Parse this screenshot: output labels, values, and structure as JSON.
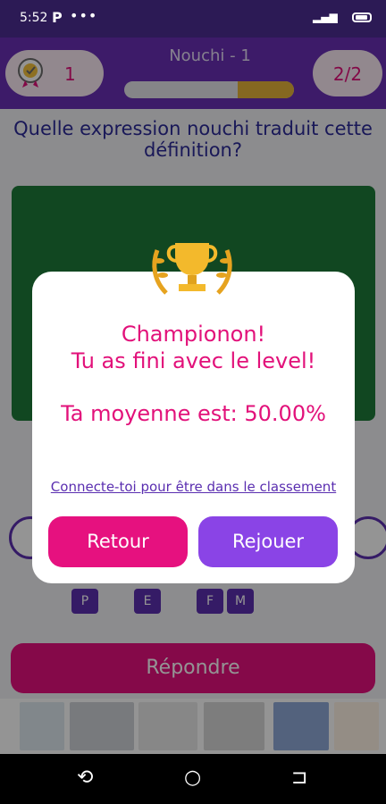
{
  "status_bar": {
    "time": "5:52",
    "app_badge": "P",
    "dots": "•••"
  },
  "header": {
    "score": "1",
    "level_title": "Nouchi - 1",
    "counter": "2/2",
    "progress": 0.33
  },
  "question": {
    "text": "Quelle expression nouchi traduit cette définition?"
  },
  "letters": [
    "P",
    "E",
    "F",
    "M"
  ],
  "answer_button": {
    "label": "Répondre"
  },
  "modal": {
    "line1": "Championon!",
    "line2": "Tu as fini avec le level!",
    "average": "Ta moyenne est: 50.00%",
    "link": "Connecte-toi pour être dans le classement",
    "back_label": "Retour",
    "replay_label": "Rejouer"
  },
  "colors": {
    "primary": "#6a2fb5",
    "accent": "#e6117f",
    "gold": "#e6b43a",
    "green": "#1e7a3a"
  }
}
